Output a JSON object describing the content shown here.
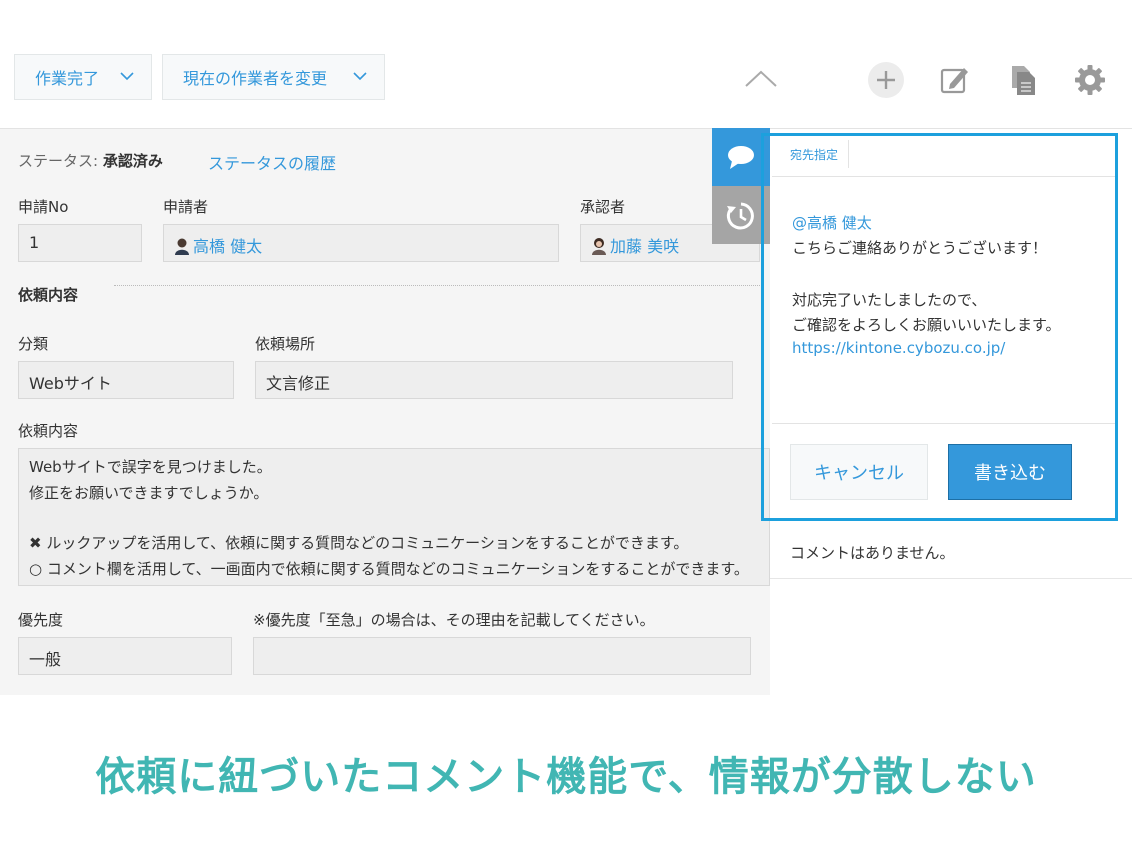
{
  "toolbar": {
    "action_primary": "作業完了",
    "action_secondary": "現在の作業者を変更"
  },
  "status": {
    "label": "ステータス:",
    "value": "承認済み",
    "history_link": "ステータスの履歴"
  },
  "fields": {
    "application_no": {
      "label": "申請No",
      "value": "1"
    },
    "applicant": {
      "label": "申請者",
      "value": "高橋 健太"
    },
    "approver": {
      "label": "承認者",
      "value": "加藤 美咲"
    },
    "section_title": "依頼内容",
    "category": {
      "label": "分類",
      "value": "Webサイト"
    },
    "request_location": {
      "label": "依頼場所",
      "value": "文言修正"
    },
    "request_details": {
      "label": "依頼内容",
      "lines": [
        "Webサイトで誤字を見つけました。",
        "修正をお願いできますでしょうか。",
        "",
        "✖ ルックアップを活用して、依頼に関する質問などのコミュニケーションをすることができます。",
        "○ コメント欄を活用して、一画面内で依頼に関する質問などのコミュニケーションをすることができます。"
      ]
    },
    "priority": {
      "label": "優先度",
      "value": "一般"
    },
    "urgent_reason": {
      "label": "※優先度「至急」の場合は、その理由を記載してください。",
      "value": ""
    }
  },
  "comment": {
    "mention_tab": "宛先指定",
    "mention": "@高橋 健太",
    "lines": [
      "こちらご連絡ありがとうございます！",
      "",
      "対応完了いたしましたので、",
      "ご確認をよろしくお願いいいたします。"
    ],
    "link": "https://kintone.cybozu.co.jp/",
    "cancel_label": "キャンセル",
    "submit_label": "書き込む",
    "empty_message": "コメントはありません。"
  },
  "caption": "依頼に紐づいたコメント機能で、情報が分散しない",
  "colors": {
    "accent": "#3498db",
    "highlight": "#1ca0dd",
    "caption": "#41b6b3"
  }
}
